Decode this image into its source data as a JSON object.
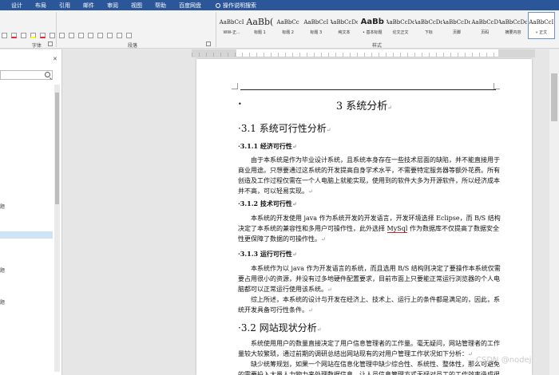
{
  "ribbon": {
    "tabs": [
      "设计",
      "布局",
      "引用",
      "邮件",
      "审阅",
      "视图",
      "帮助",
      "百度网盘"
    ],
    "tell_me": "操作说明搜索",
    "groups": {
      "font": "字体",
      "paragraph": "段落",
      "styles": "样式"
    },
    "styles": [
      {
        "sample": "AaBbCcI",
        "name": "WW-正..."
      },
      {
        "sample": "AaBb(",
        "name": "标题 1"
      },
      {
        "sample": "AaBbCc",
        "name": "标题 2"
      },
      {
        "sample": "AaBbCcI",
        "name": "标题 3"
      },
      {
        "sample": "AaBbCcDc",
        "name": "纯文本"
      },
      {
        "sample": "AaBb",
        "name": "• 基本标题"
      },
      {
        "sample": "AaBbCcDd",
        "name": "论文正文"
      },
      {
        "sample": "AaBbCcDd",
        "name": "下标"
      },
      {
        "sample": "AaBbCcDd",
        "name": "页脚"
      },
      {
        "sample": "AaBbCcD",
        "name": "页码"
      },
      {
        "sample": "AaBbCcDd",
        "name": "摘要内容"
      },
      {
        "sample": "AaBbCcI",
        "name": "» 正文"
      }
    ]
  },
  "nav": {
    "item_1": "题",
    "item_2": "题",
    "item_3": "题"
  },
  "doc": {
    "chapter": "3  系统分析",
    "s31": "3.1  系统可行性分析",
    "s311": "3.1.1  经济可行性",
    "p1": "由于本系统是作为毕业设计系统，且系统本身存在一些技术层面的缺陷，并不能直接用于商业用途。只想要通过这系统的开发提高自身学术水平，不需要特定服务器等额外花费。所有创造及工作过程仅需在一个人电脑上就能实现，使用到的软件大多为开源软件，所以经济成本并不高，可以轻易实现。",
    "s312": "3.1.2  技术可行性",
    "p2a": "本系统的开发使用 java 作为系统开发的开发语言，开发环境选择 Eclipse，而 B/S 结构决定了本系统的兼容性和多用户可操作性，此外选择 ",
    "p2_mysql": "MySql",
    "p2b": " 作为数据库不仅提高了数据安全性更保障了数据的可操作性。",
    "s313": "3.1.3  运行可行性",
    "p3": "本系统作为以 java 作为开发语言的系统，而且选用 B/S 结构则决定了要操作本系统仅需要占用很小的资源，并没有过多地硬件配置要求，目前市面上只要能正常运行浏览器的个人电脑都可以正常运行使用该系统。",
    "p4": "综上所述，本系统的设计与开发在经济上、技术上、运行上的条件都是满足的，因此，系统开发具备可行性条件。",
    "s32": "3.2  网站现状分析",
    "p5": "系统使用用户的数量直接决定了用户信息管理者的工作量。毫无疑问，网站管理者的工作量较大较繁琐，通过前期的调研总结出网站现有的对用户管理工作状况如下分析：",
    "p6": "缺少统筹规划，如果一个网站在信息化管理中缺少综合性、系统性、整体性，那么可避免的需要投入大量人力物力来处理数据信息，让人员信息管理方式无疑对员工的工作效率造成很大的影响。"
  },
  "watermark": "CSDN @nodej"
}
